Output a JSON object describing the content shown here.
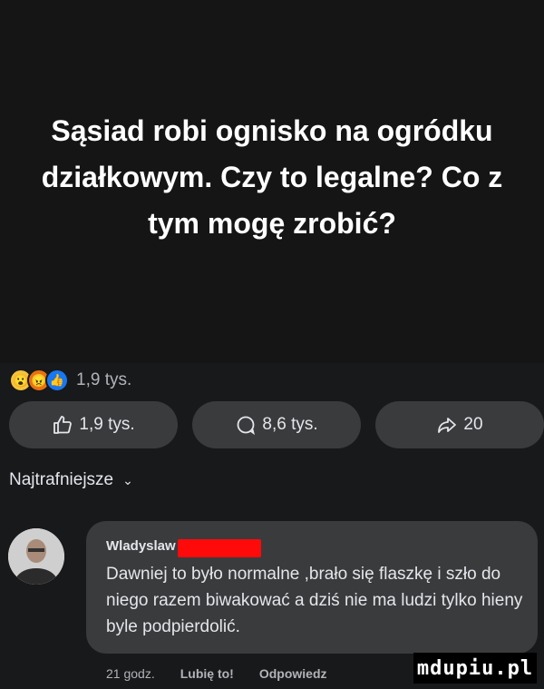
{
  "post": {
    "text": "Sąsiad robi ognisko na ogródku działkowym. Czy to legalne? Co z tym mogę zrobić?"
  },
  "reactions": {
    "icons": [
      "wow-emoji-icon",
      "angry-emoji-icon",
      "like-emoji-icon"
    ],
    "count": "1,9 tys."
  },
  "actions": {
    "like": "1,9 tys.",
    "comments": "8,6 tys.",
    "shares": "20"
  },
  "sort": {
    "label": "Najtrafniejsze"
  },
  "comment": {
    "author": "Wladyslaw",
    "text": "Dawniej to było normalne ,brało się flaszkę i szło do niego razem biwakować a dziś nie ma ludzi tylko hieny byle podpierdolić.",
    "time": "21 godz.",
    "like_label": "Lubię to!",
    "reply_label": "Odpowiedz"
  },
  "watermark": "mdupiu.pl",
  "colors": {
    "background": "#18191b",
    "button": "#3a3b3c",
    "redaction": "#ff0a0a",
    "like_blue": "#1877f2"
  }
}
